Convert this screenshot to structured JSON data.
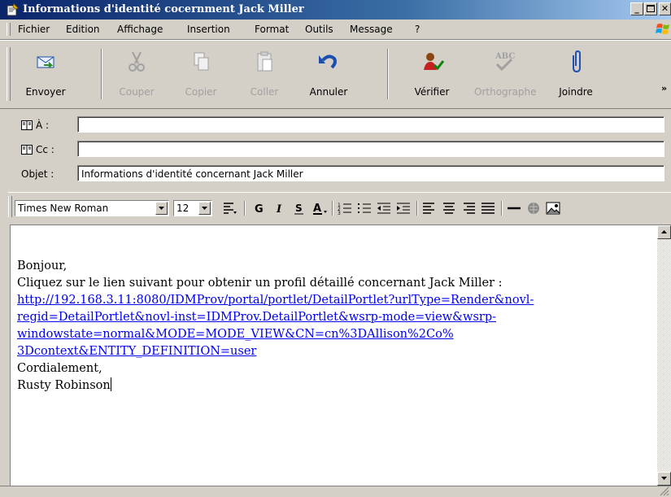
{
  "window": {
    "title": "Informations d'identité cocernment Jack Miller"
  },
  "menu": [
    {
      "label": "Fichier"
    },
    {
      "label": "Edition"
    },
    {
      "label": "Affichage"
    },
    {
      "label": "Insertion"
    },
    {
      "label": "Format"
    },
    {
      "label": "Outils"
    },
    {
      "label": "Message"
    },
    {
      "label": "?"
    }
  ],
  "toolbar": {
    "send": "Envoyer",
    "cut": "Couper",
    "copy": "Copier",
    "paste": "Coller",
    "undo": "Annuler",
    "check": "Vérifier",
    "spelling": "Orthographe",
    "attach": "Joindre",
    "more": "»"
  },
  "header": {
    "to_label": "À :",
    "to_value": "",
    "cc_label": "Cc :",
    "cc_value": "",
    "subject_label": "Objet :",
    "subject_value": "Informations d'identité concernant Jack Miller"
  },
  "format": {
    "font": "Times New Roman",
    "size": "12"
  },
  "body": {
    "greeting": "Bonjour,",
    "intro": "Cliquez sur le lien suivant pour obtenir un profil détaillé concernant Jack Miller :",
    "link_line1": "http://192.168.3.11:8080/IDMProv/portal/portlet/DetailPortlet?urlType=Render&novl-",
    "link_line2": "regid=DetailPortlet&novl-inst=IDMProv.DetailPortlet&wsrp-mode=view&wsrp-",
    "link_line3": "windowstate=normal&MODE=MODE_VIEW&CN=cn%3DAllison%2Co%",
    "link_line4": "3Dcontext&ENTITY_DEFINITION=user",
    "closing": "Cordialement,",
    "signature": "Rusty Robinson"
  }
}
